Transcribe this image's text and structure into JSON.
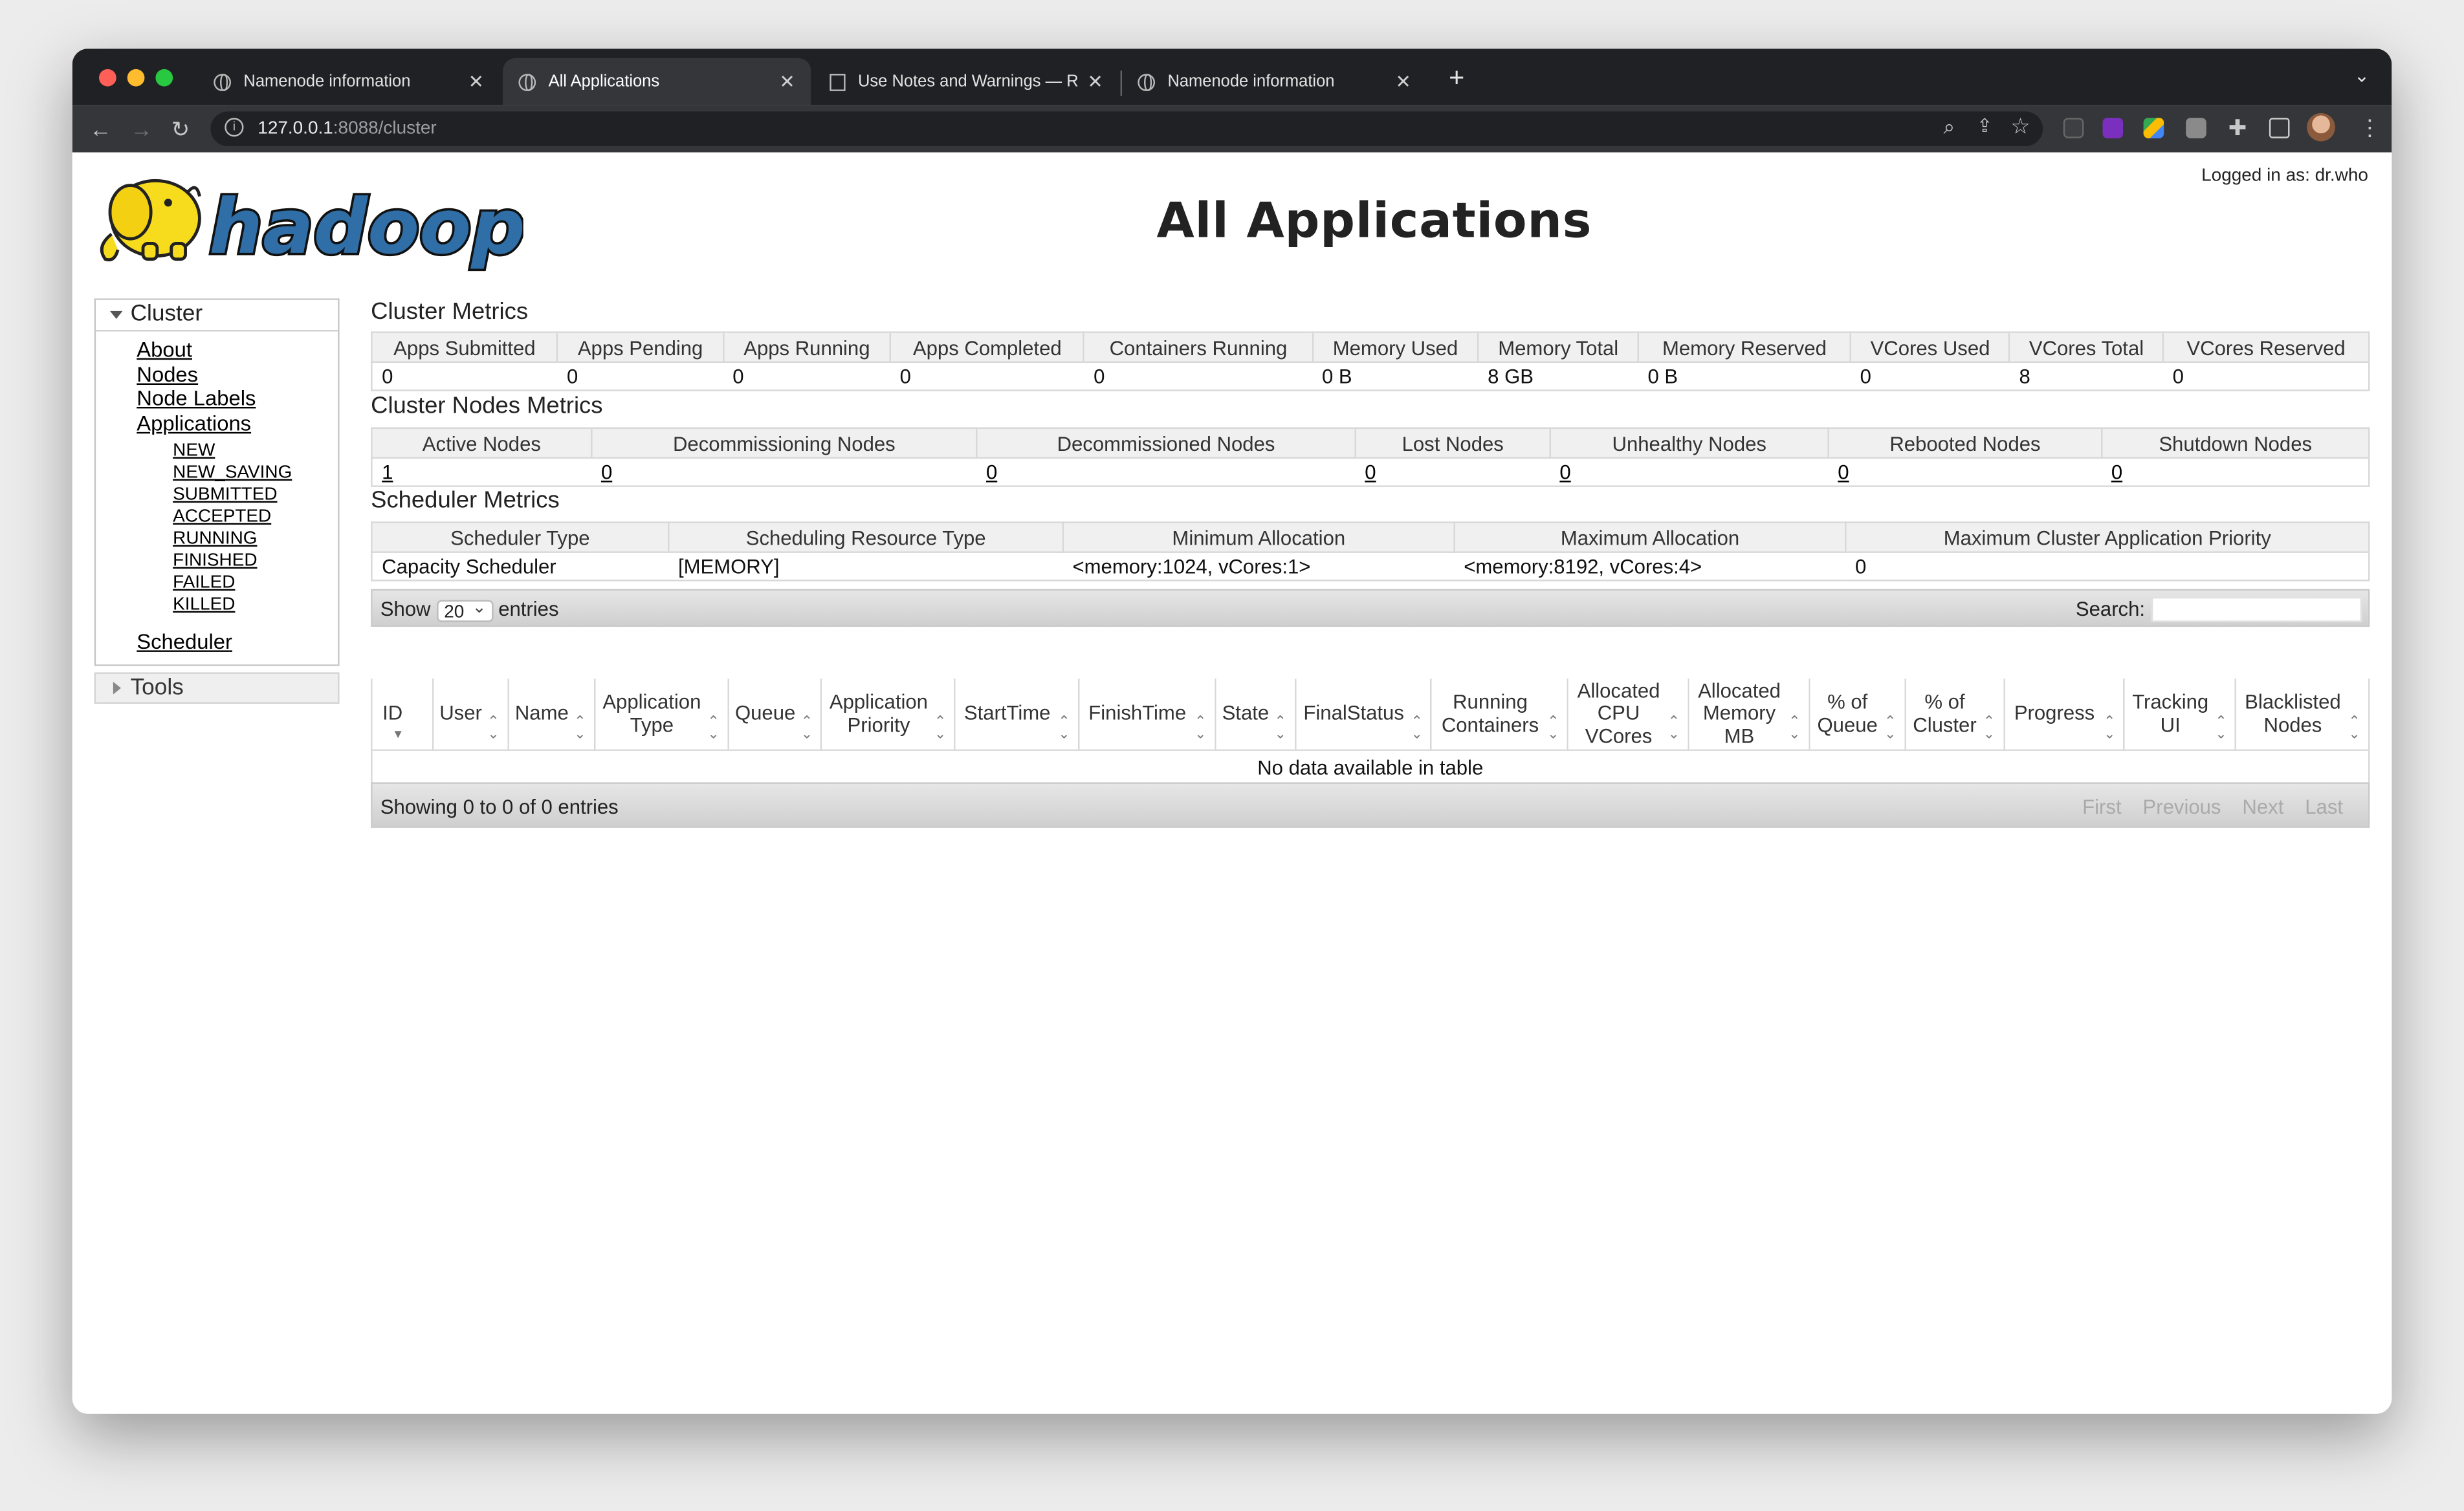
{
  "browser": {
    "tabs": [
      {
        "title": "Namenode information",
        "active": false
      },
      {
        "title": "All Applications",
        "active": true
      },
      {
        "title": "Use Notes and Warnings — RS",
        "active": false
      },
      {
        "title": "Namenode information",
        "active": false
      }
    ],
    "url_host": "127.0.0.1",
    "url_rest": ":8088/cluster"
  },
  "header": {
    "logo_text": "hadoop",
    "title": "All Applications",
    "logged_in": "Logged in as: dr.who"
  },
  "nav": {
    "cluster_label": "Cluster",
    "items": [
      "About",
      "Nodes",
      "Node Labels",
      "Applications"
    ],
    "app_states": [
      "NEW",
      "NEW_SAVING",
      "SUBMITTED",
      "ACCEPTED",
      "RUNNING",
      "FINISHED",
      "FAILED",
      "KILLED"
    ],
    "scheduler": "Scheduler",
    "tools_label": "Tools"
  },
  "cluster_metrics": {
    "title": "Cluster Metrics",
    "headers": [
      "Apps Submitted",
      "Apps Pending",
      "Apps Running",
      "Apps Completed",
      "Containers Running",
      "Memory Used",
      "Memory Total",
      "Memory Reserved",
      "VCores Used",
      "VCores Total",
      "VCores Reserved"
    ],
    "values": [
      "0",
      "0",
      "0",
      "0",
      "0",
      "0 B",
      "8 GB",
      "0 B",
      "0",
      "8",
      "0"
    ]
  },
  "node_metrics": {
    "title": "Cluster Nodes Metrics",
    "headers": [
      "Active Nodes",
      "Decommissioning Nodes",
      "Decommissioned Nodes",
      "Lost Nodes",
      "Unhealthy Nodes",
      "Rebooted Nodes",
      "Shutdown Nodes"
    ],
    "values": [
      "1",
      "0",
      "0",
      "0",
      "0",
      "0",
      "0"
    ]
  },
  "scheduler_metrics": {
    "title": "Scheduler Metrics",
    "headers": [
      "Scheduler Type",
      "Scheduling Resource Type",
      "Minimum Allocation",
      "Maximum Allocation",
      "Maximum Cluster Application Priority"
    ],
    "values": [
      "Capacity Scheduler",
      "[MEMORY]",
      "<memory:1024, vCores:1>",
      "<memory:8192, vCores:4>",
      "0"
    ]
  },
  "apps_table": {
    "show_label": "Show",
    "page_size": "20",
    "entries_label": "entries",
    "search_label": "Search:",
    "columns": [
      "ID",
      "User",
      "Name",
      "Application Type",
      "Queue",
      "Application Priority",
      "StartTime",
      "FinishTime",
      "State",
      "FinalStatus",
      "Running Containers",
      "Allocated CPU VCores",
      "Allocated Memory MB",
      "% of Queue",
      "% of Cluster",
      "Progress",
      "Tracking UI",
      "Blacklisted Nodes"
    ],
    "empty_message": "No data available in table",
    "info": "Showing 0 to 0 of 0 entries",
    "pager": [
      "First",
      "Previous",
      "Next",
      "Last"
    ]
  }
}
